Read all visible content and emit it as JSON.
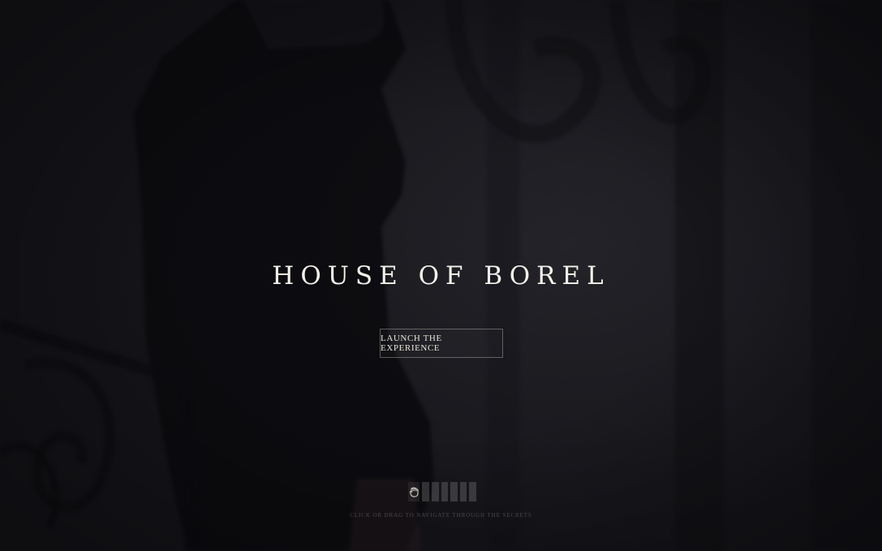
{
  "hero": {
    "title": "HOUSE OF BOREL",
    "launch_label": "LAUNCH THE EXPERIENCE"
  },
  "navigator": {
    "hint": "CLICK OR DRAG TO NAVIGATE THROUGH THE SECRETS",
    "slides": 7,
    "active_slide": 1,
    "icon": "grab-hand-icon"
  },
  "colors": {
    "background": "#16161a",
    "title": "#f4f1ea",
    "button_border": "#e6e2d7"
  }
}
